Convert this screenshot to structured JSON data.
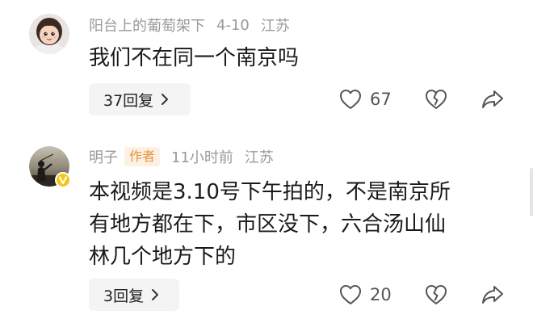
{
  "comments": [
    {
      "username": "阳台上的葡萄架下",
      "date": "4-10",
      "location": "江苏",
      "badge": "",
      "lines": [
        "我们不在同一个南京吗"
      ],
      "replies": "37回复",
      "likes": "67"
    },
    {
      "username": "明子",
      "date": "11小时前",
      "location": "江苏",
      "badge": "作者",
      "lines": [
        "本视频是3.10号下午拍的，不是南京所",
        "有地方都在下，市区没下，六合汤山仙",
        "林几个地方下的"
      ],
      "replies": "3回复",
      "likes": "20"
    }
  ],
  "icons": {
    "like": "heart-outline-icon",
    "dislike": "broken-heart-icon",
    "share": "share-arrow-icon",
    "reply_more": "chevron-right-icon",
    "verified": "verified-v-badge-icon"
  },
  "colors": {
    "meta_text": "#9a9a9a",
    "author_badge_bg": "#fdf1e4",
    "author_badge_text": "#e8903a",
    "verified_badge": "#f5c518"
  }
}
